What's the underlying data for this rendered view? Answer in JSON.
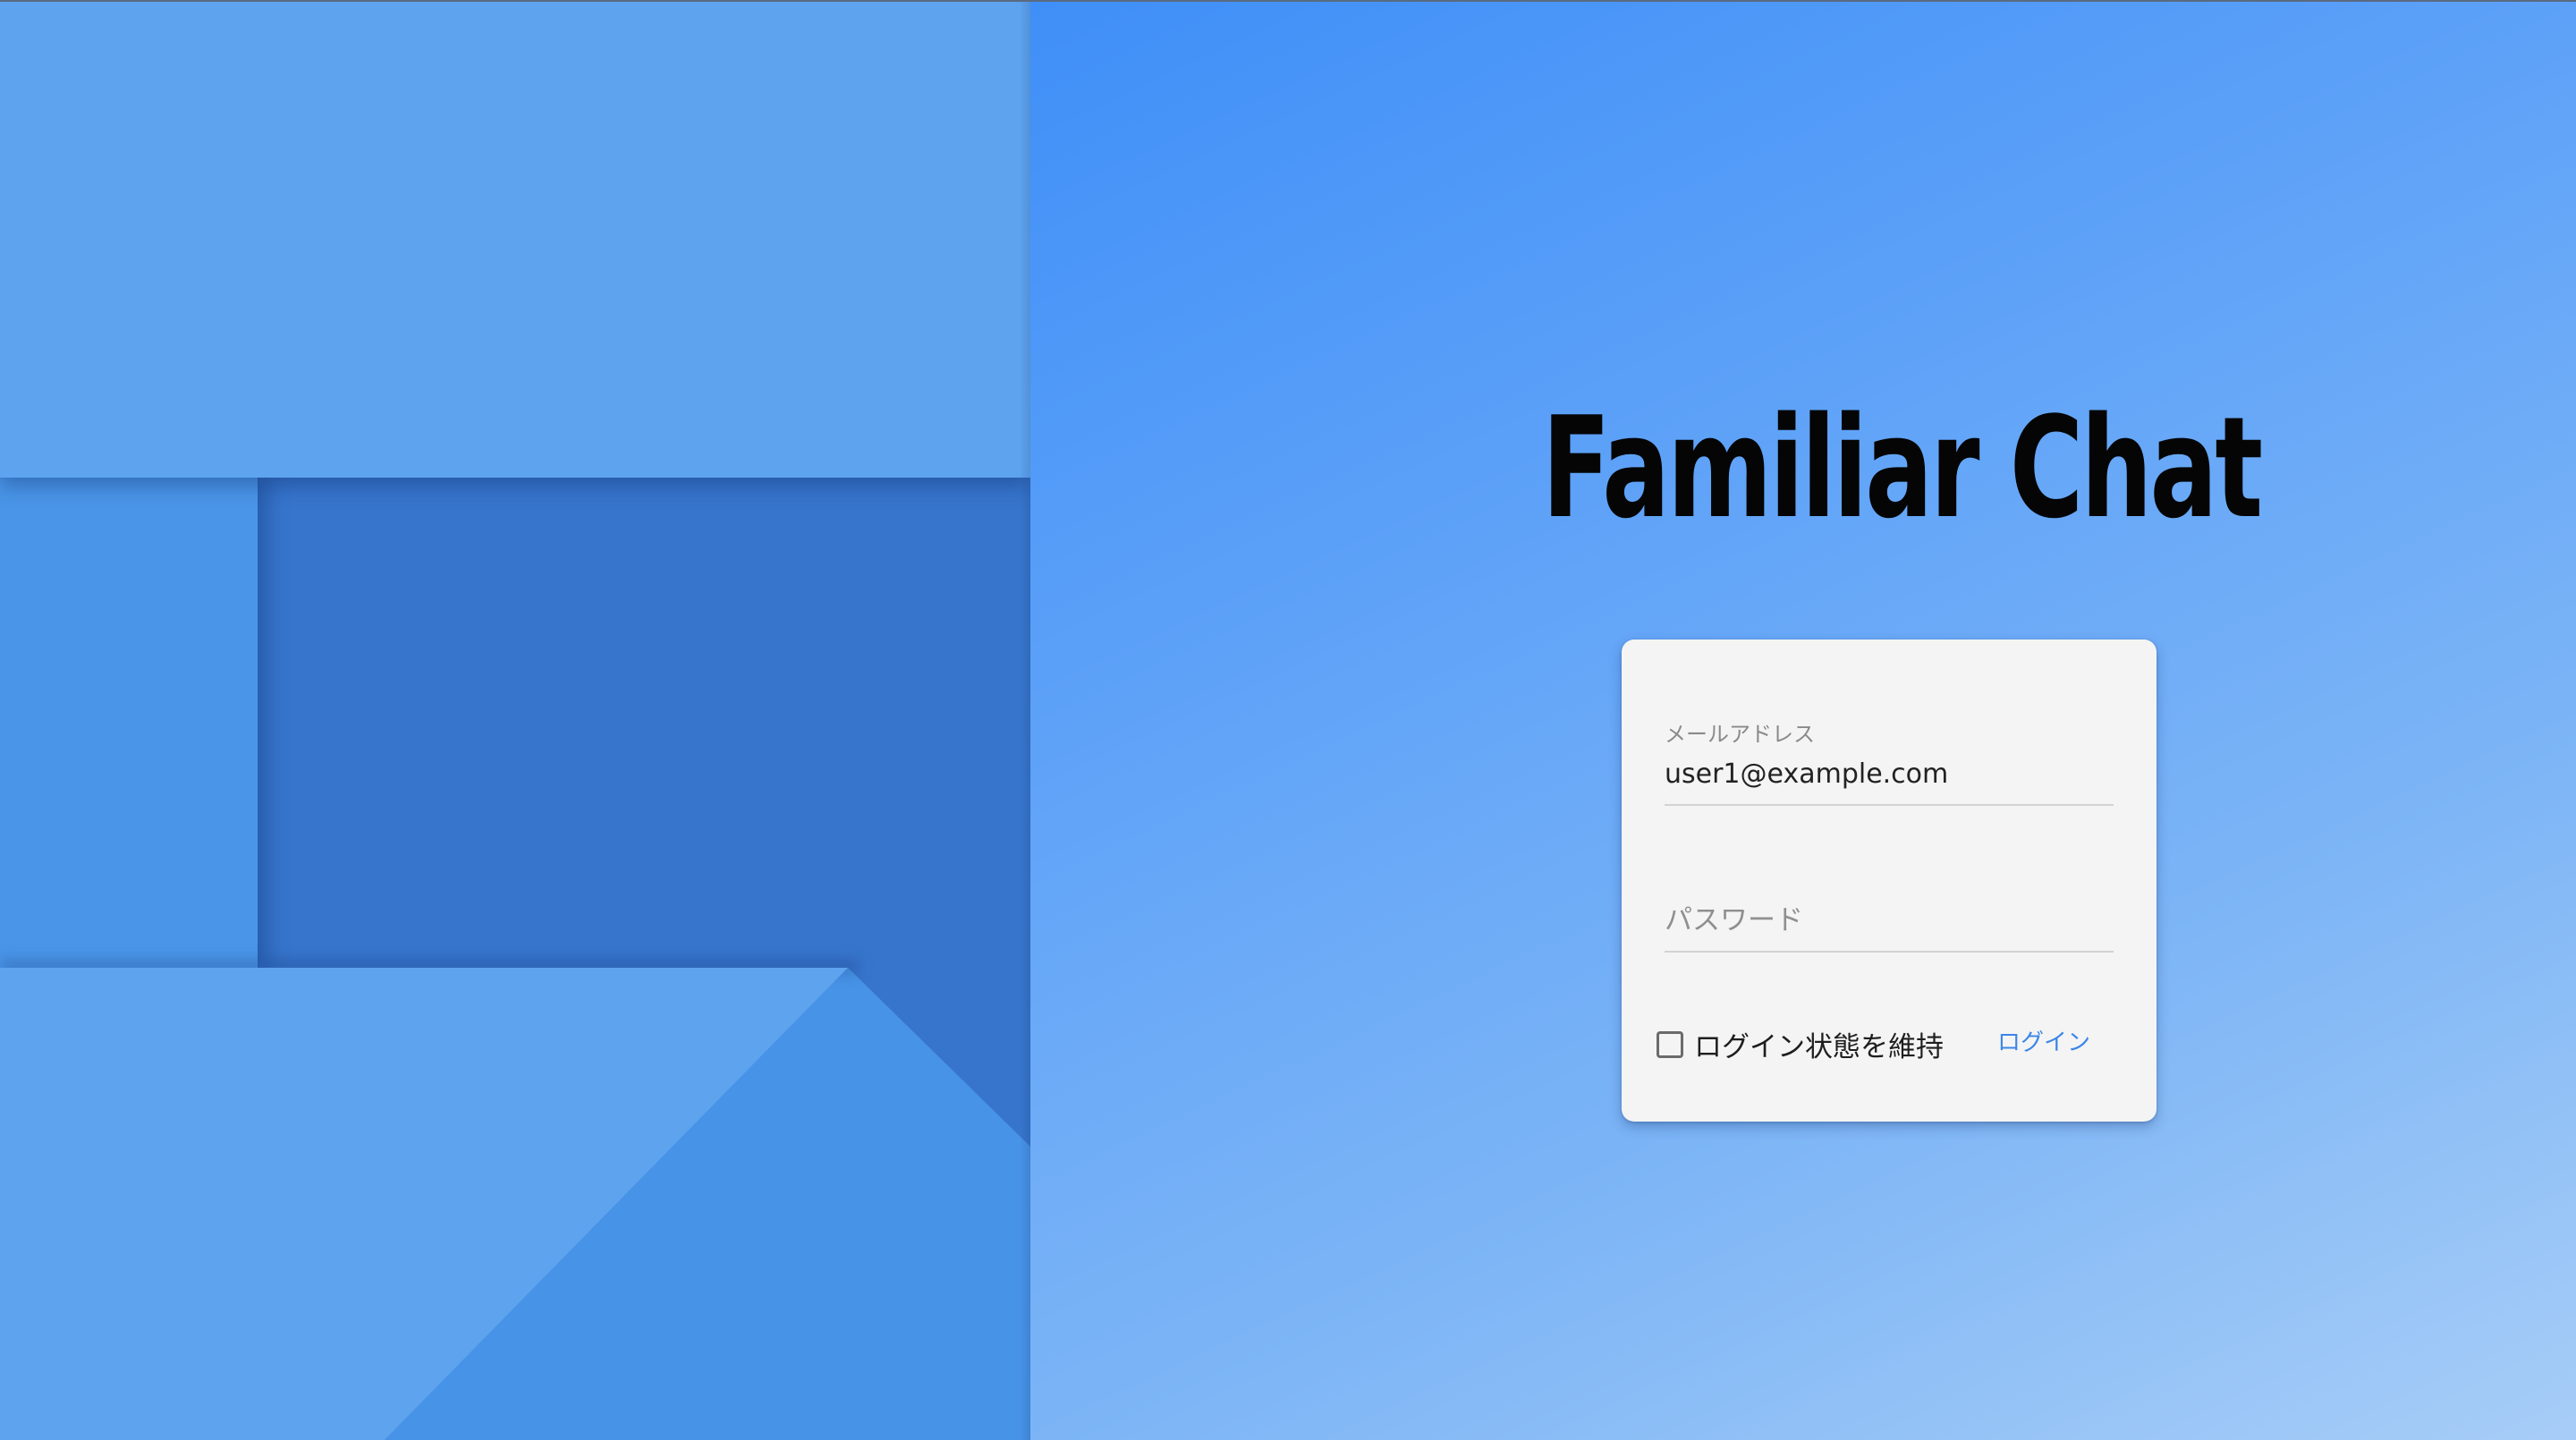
{
  "app": {
    "title": "Familiar Chat"
  },
  "login_form": {
    "email": {
      "label": "メールアドレス",
      "value": "user1@example.com"
    },
    "password": {
      "placeholder": "パスワード",
      "value": ""
    },
    "remember_me": {
      "label": "ログイン状態を維持",
      "checked": false
    },
    "submit_label": "ログイン"
  },
  "colors": {
    "gradient_start": "#3f8ff8",
    "gradient_end": "#a7cdf7",
    "card_background": "#f4f4f4",
    "link_accent": "#3b86e8",
    "title_text": "#050505",
    "panel_light": "#5da3ee",
    "panel_dark": "#3775cc"
  }
}
